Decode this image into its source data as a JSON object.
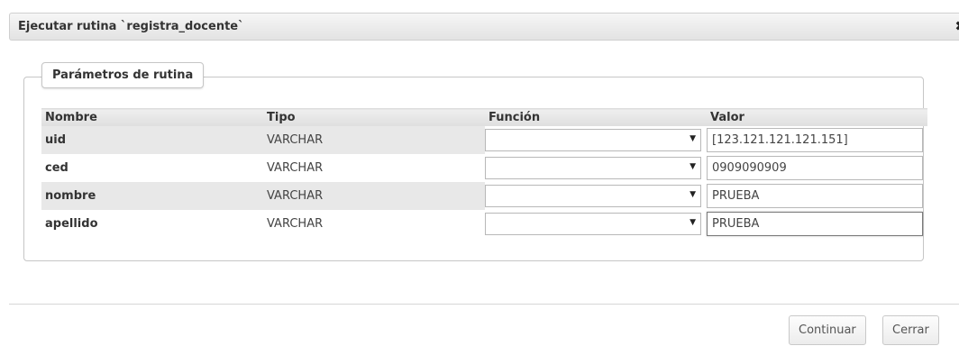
{
  "dialog": {
    "title": "Ejecutar rutina `registra_docente`",
    "close_icon": "✖"
  },
  "fieldset": {
    "legend": "Parámetros de rutina"
  },
  "table": {
    "headers": {
      "name": "Nombre",
      "type": "Tipo",
      "function": "Función",
      "value": "Valor"
    },
    "rows": [
      {
        "name": "uid",
        "type": "VARCHAR",
        "function": "",
        "value": "[123.121.121.121.151]"
      },
      {
        "name": "ced",
        "type": "VARCHAR",
        "function": "",
        "value": "0909090909"
      },
      {
        "name": "nombre",
        "type": "VARCHAR",
        "function": "",
        "value": "PRUEBA"
      },
      {
        "name": "apellido",
        "type": "VARCHAR",
        "function": "",
        "value": "PRUEBA"
      }
    ],
    "select_caret": "▼"
  },
  "footer": {
    "continue_label": "Continuar",
    "close_label": "Cerrar"
  }
}
